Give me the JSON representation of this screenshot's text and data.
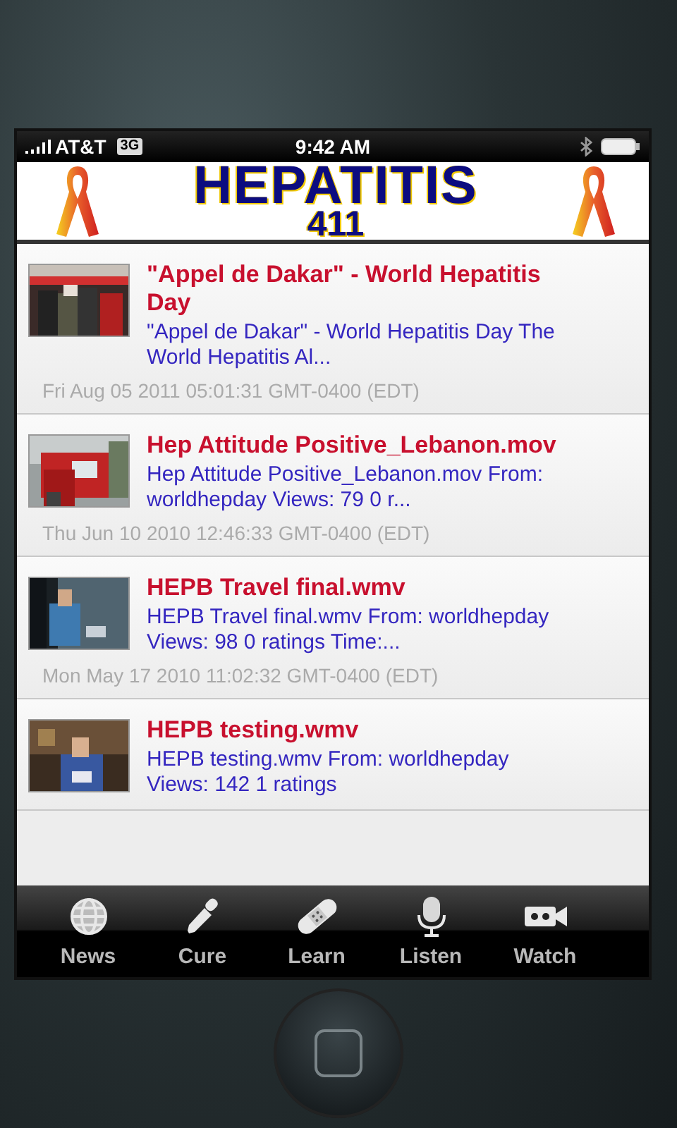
{
  "status_bar": {
    "carrier": "AT&T",
    "network": "3G",
    "time": "9:42 AM"
  },
  "header": {
    "title": "HEPATITIS",
    "subtitle": "411"
  },
  "videos": [
    {
      "title": "\"Appel de Dakar\" - World Hepatitis Day",
      "description": "\"Appel de Dakar\" - World Hepatitis Day The World Hepatitis Al...",
      "date": "Fri Aug 05 2011 05:01:31 GMT-0400 (EDT)"
    },
    {
      "title": "Hep Attitude Positive_Lebanon.mov",
      "description": "Hep Attitude Positive_Lebanon.mov From: worldhepday Views: 79 0 r...",
      "date": "Thu Jun 10 2010 12:46:33 GMT-0400 (EDT)"
    },
    {
      "title": "HEPB Travel final.wmv",
      "description": "HEPB Travel final.wmv From: worldhepday Views: 98 0 ratings Time:...",
      "date": "Mon May 17 2010 11:02:32 GMT-0400 (EDT)"
    },
    {
      "title": "HEPB testing.wmv",
      "description": "HEPB testing.wmv From: worldhepday Views: 142 1 ratings"
    }
  ],
  "tab_bar": [
    {
      "label": "News"
    },
    {
      "label": "Cure"
    },
    {
      "label": "Learn"
    },
    {
      "label": "Listen"
    },
    {
      "label": "Watch"
    }
  ]
}
